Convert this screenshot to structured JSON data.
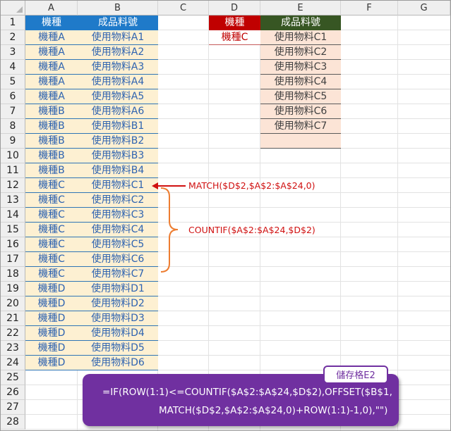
{
  "sheet": {
    "columns": [
      "A",
      "B",
      "C",
      "D",
      "E",
      "F",
      "G"
    ],
    "rows": [
      "1",
      "2",
      "3",
      "4",
      "5",
      "6",
      "7",
      "8",
      "9",
      "10",
      "11",
      "12",
      "13",
      "14",
      "15",
      "16",
      "17",
      "18",
      "19",
      "20",
      "21",
      "22",
      "23",
      "24",
      "25",
      "26",
      "27",
      "28"
    ]
  },
  "headers": {
    "a": "機種",
    "b": "成品料號",
    "d": "機種",
    "e": "成品料號"
  },
  "table_a": [
    [
      "機種A",
      "使用物料A1"
    ],
    [
      "機種A",
      "使用物料A2"
    ],
    [
      "機種A",
      "使用物料A3"
    ],
    [
      "機種A",
      "使用物料A4"
    ],
    [
      "機種A",
      "使用物料A5"
    ],
    [
      "機種B",
      "使用物料A6"
    ],
    [
      "機種B",
      "使用物料B1"
    ],
    [
      "機種B",
      "使用物料B2"
    ],
    [
      "機種B",
      "使用物料B3"
    ],
    [
      "機種B",
      "使用物料B4"
    ],
    [
      "機種C",
      "使用物料C1"
    ],
    [
      "機種C",
      "使用物料C2"
    ],
    [
      "機種C",
      "使用物料C3"
    ],
    [
      "機種C",
      "使用物料C4"
    ],
    [
      "機種C",
      "使用物料C5"
    ],
    [
      "機種C",
      "使用物料C6"
    ],
    [
      "機種C",
      "使用物料C7"
    ],
    [
      "機種D",
      "使用物料D1"
    ],
    [
      "機種D",
      "使用物料D2"
    ],
    [
      "機種D",
      "使用物料D3"
    ],
    [
      "機種D",
      "使用物料D4"
    ],
    [
      "機種D",
      "使用物料D5"
    ],
    [
      "機種D",
      "使用物料D6"
    ]
  ],
  "lookup": {
    "d2": "機種C",
    "results": [
      "使用物料C1",
      "使用物料C2",
      "使用物料C3",
      "使用物料C4",
      "使用物料C5",
      "使用物料C6",
      "使用物料C7",
      ""
    ]
  },
  "annotations": {
    "match": "MATCH($D$2,$A$2:$A$24,0)",
    "countif": "COUNTIF($A$2:$A$24,$D$2)"
  },
  "callout": {
    "badge": "儲存格E2",
    "line1": "=IF(ROW(1:1)<=COUNTIF($A$2:$A$24,$D$2),OFFSET($B$1,",
    "line2": "MATCH($D$2,$A$2:$A$24,0)+ROW(1:1)-1,0),\"\")"
  },
  "colors": {
    "blue_header": "#1f7ac9",
    "red_header": "#c00000",
    "green_header": "#375623",
    "data_fill": "#fdf0d2",
    "result_fill": "#fce4d6",
    "callout": "#7030a0",
    "annotation": "#d01010",
    "brace": "#ed7d31"
  }
}
